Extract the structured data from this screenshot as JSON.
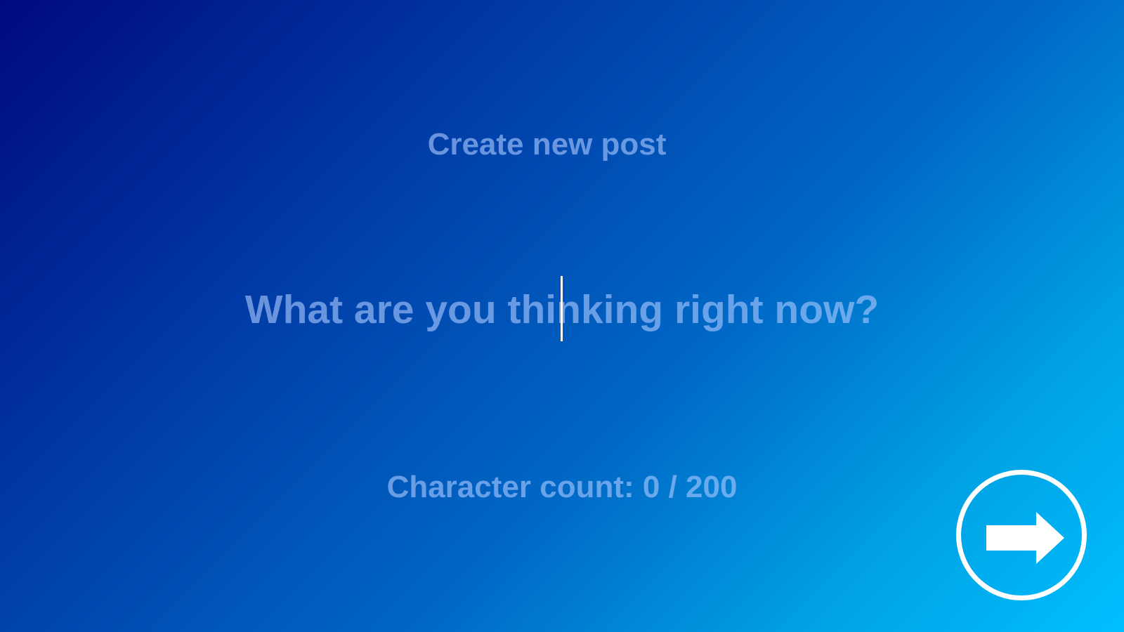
{
  "composer": {
    "title": "Create new post",
    "placeholder": "What are you thinking right now?",
    "char_count_label": "Character count:",
    "char_count_value": "0 / 200",
    "next_icon": "arrow-right-icon"
  },
  "colors": {
    "background_start": "#000a7e",
    "background_end": "#00bfff",
    "text": "#aac8ff",
    "accent": "#ffffff"
  }
}
